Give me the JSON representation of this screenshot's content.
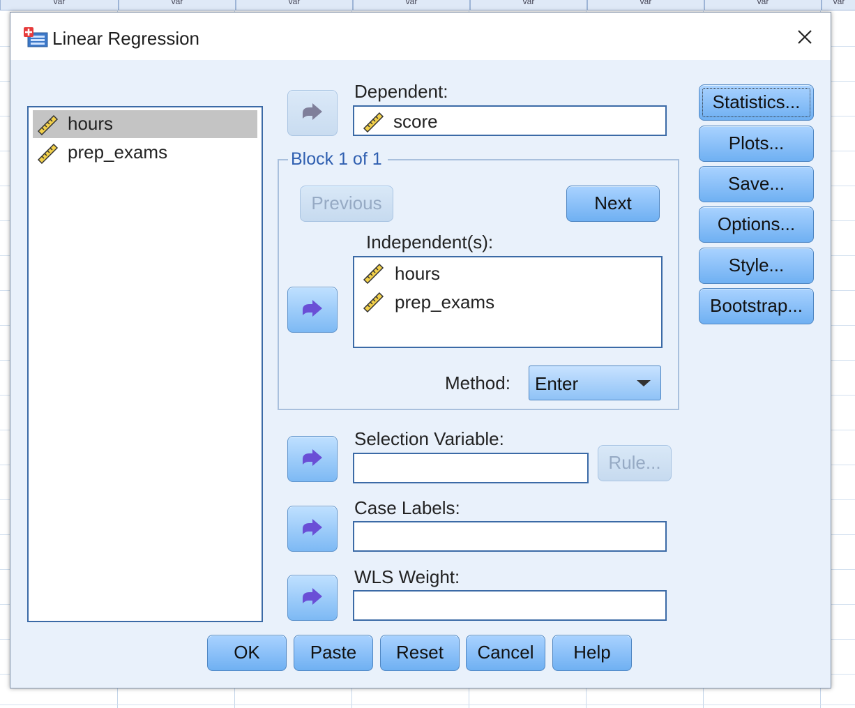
{
  "background": {
    "column_header_label": "var"
  },
  "dialog": {
    "title": "Linear Regression",
    "icon": "spss-dialog-icon",
    "close_icon": "close-icon"
  },
  "variables": [
    {
      "name": "hours",
      "icon": "scale-ruler-icon",
      "selected": true
    },
    {
      "name": "prep_exams",
      "icon": "scale-ruler-icon",
      "selected": false
    }
  ],
  "dependent": {
    "label": "Dependent:",
    "value": "score"
  },
  "block": {
    "legend": "Block 1 of 1",
    "previous": "Previous",
    "next": "Next"
  },
  "independents": {
    "label": "Independent(s):",
    "items": [
      "hours",
      "prep_exams"
    ]
  },
  "method": {
    "label": "Method:",
    "value": "Enter"
  },
  "selection_variable": {
    "label": "Selection Variable:",
    "value": "",
    "rule_button": "Rule..."
  },
  "case_labels": {
    "label": "Case Labels:",
    "value": ""
  },
  "wls_weight": {
    "label": "WLS Weight:",
    "value": ""
  },
  "side_buttons": {
    "statistics": "Statistics...",
    "plots": "Plots...",
    "save": "Save...",
    "options": "Options...",
    "style": "Style...",
    "bootstrap": "Bootstrap..."
  },
  "bottom_buttons": {
    "ok": "OK",
    "paste": "Paste",
    "reset": "Reset",
    "cancel": "Cancel",
    "help": "Help"
  },
  "colors": {
    "dialog_bg": "#e9f1fb",
    "button_blue": "#6fb0f2",
    "border_blue": "#3b6aa6",
    "arrow_purple": "#6a4fd6"
  }
}
